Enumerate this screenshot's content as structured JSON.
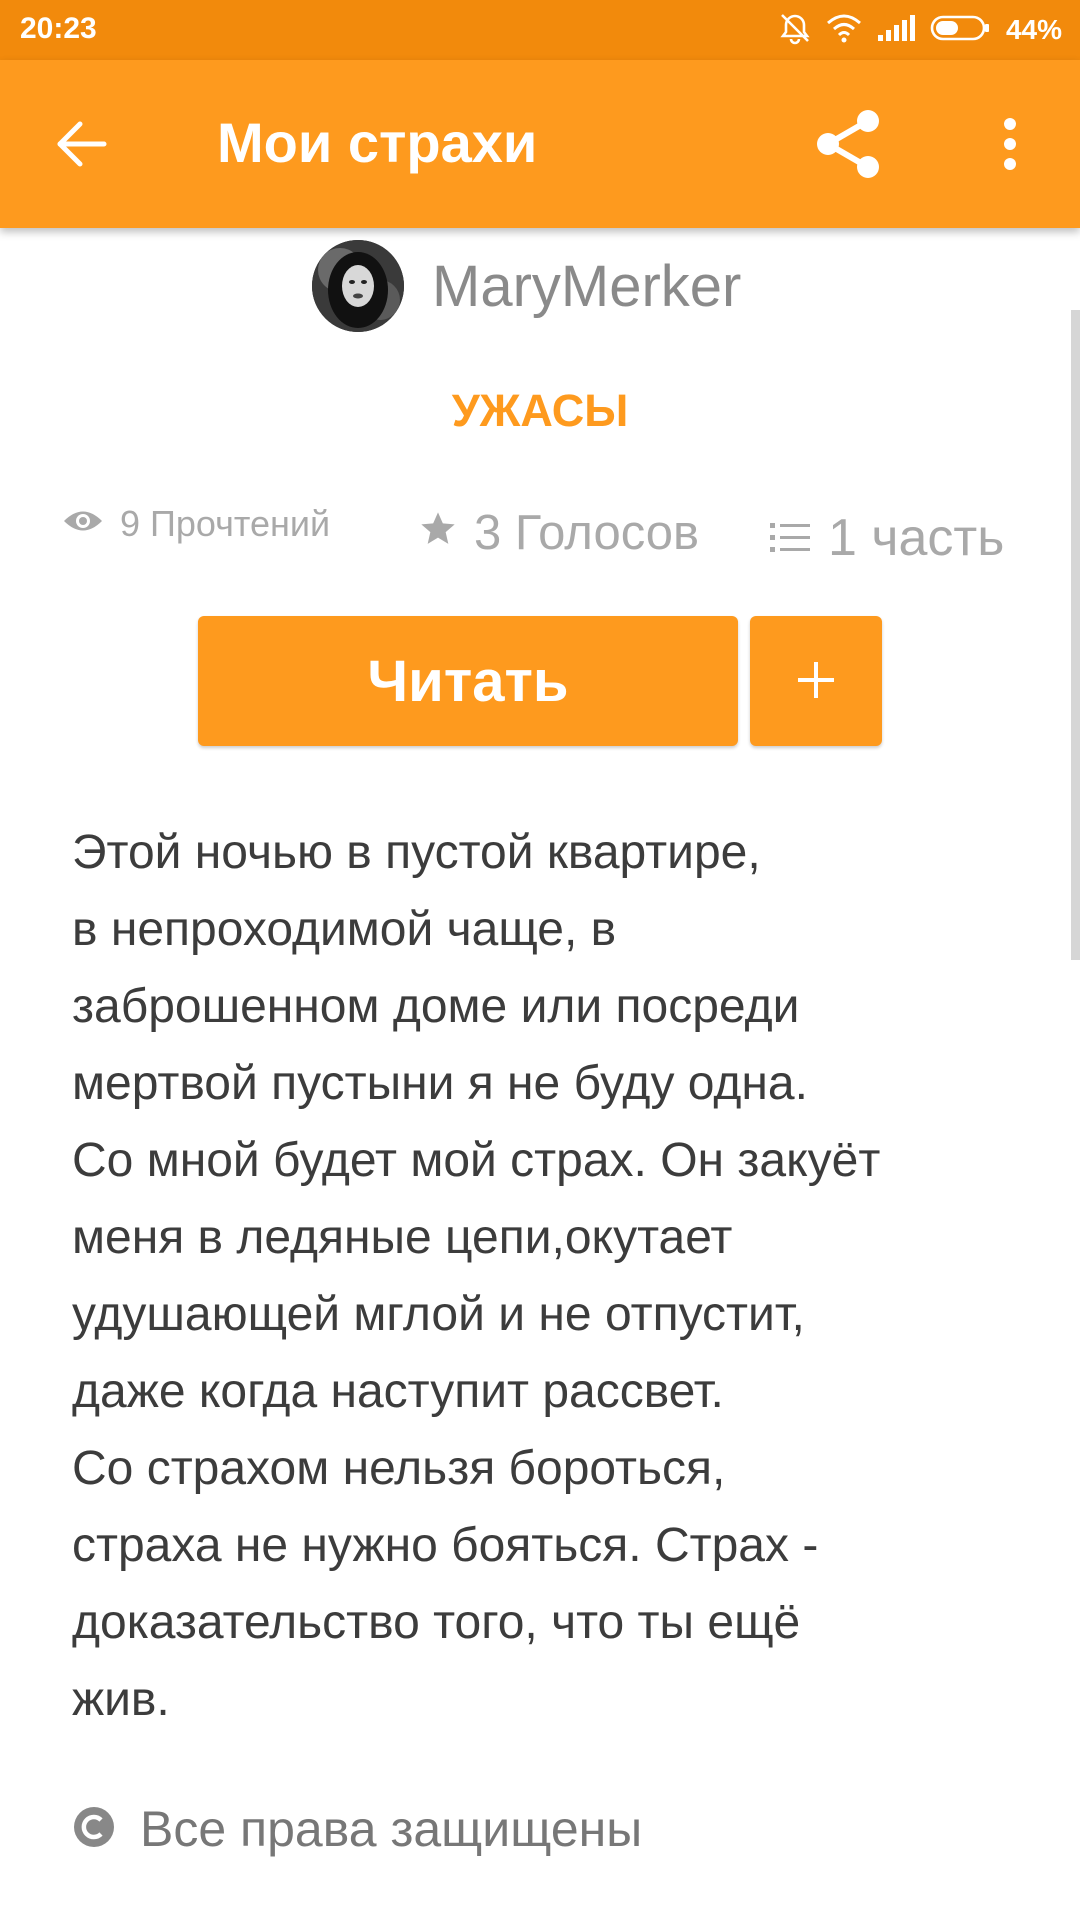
{
  "status_bar": {
    "time": "20:23",
    "battery": "44%",
    "icons": [
      "silent-alarm-icon",
      "wifi-icon",
      "signal-icon",
      "battery-icon"
    ]
  },
  "app_bar": {
    "title": "Мои страхи",
    "icons": [
      "back-arrow-icon",
      "share-icon",
      "more-vert-icon"
    ]
  },
  "story": {
    "author": "MaryMerker",
    "genre": "УЖАСЫ",
    "stats": {
      "reads": "9 Прочтений",
      "votes": "3 Голосов",
      "parts": "1 часть"
    },
    "read_button": "Читать",
    "add_button": "+",
    "description_lines": [
      "Этой ночью в пустой квартире,",
      "в непроходимой чаще, в",
      "заброшенном доме или посреди",
      "мертвой пустыни я не буду одна.",
      "Со мной будет мой страх. Он закуёт",
      "меня в ледяные цепи,окутает",
      "удушающей мглой и не отпустит,",
      "даже когда наступит рассвет.",
      "Со страхом нельзя бороться,",
      "страха не нужно бояться. Страх -",
      "доказательство того, что ты ещё",
      "жив."
    ],
    "copyright": "Все права защищены"
  },
  "colors": {
    "status_bar": "#f28a0c",
    "accent": "#fe9a1e",
    "muted_text": "#a9a9a9",
    "body_text": "#3c3c3c"
  }
}
